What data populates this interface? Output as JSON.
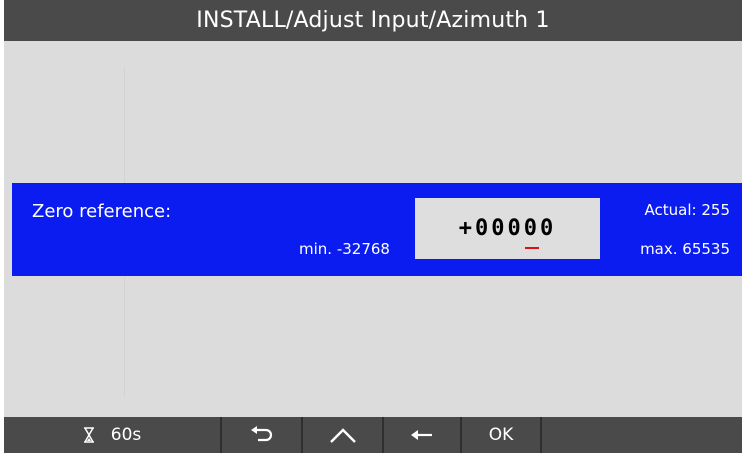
{
  "title": "INSTALL/Adjust Input/Azimuth 1",
  "parameter": {
    "label": "Zero reference:",
    "value_sign": "+",
    "value_digits_before_cursor": "000",
    "value_cursor_digit": "0",
    "value_digits_after_cursor": "0",
    "min": "min. -32768",
    "max": "max. 65535",
    "actual": "Actual: 255"
  },
  "softkeys": {
    "timer_icon": "hourglass-icon",
    "timer": "60s",
    "back_icon": "return-arrow-icon",
    "up_icon": "chevron-up-icon",
    "left_icon": "left-arrow-icon",
    "ok": "OK"
  },
  "colors": {
    "title_bar": "#4a4a4a",
    "selected_row": "#0a1cf0",
    "background": "#dcdcdc",
    "cursor": "#e01010"
  }
}
